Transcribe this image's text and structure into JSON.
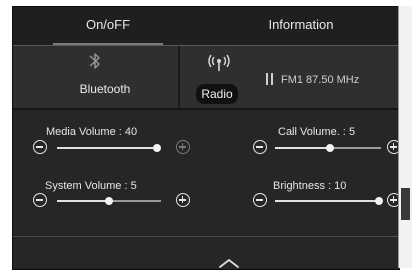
{
  "tabs": [
    {
      "label": "On/oFF",
      "active": true
    },
    {
      "label": "Information",
      "active": false
    }
  ],
  "bluetooth": {
    "label": "Bluetooth",
    "icon": "bluetooth-icon"
  },
  "radio": {
    "label": "Radio",
    "icon": "radio-antenna-icon",
    "status_icon": "pause-icon",
    "station": "FM1 87.50 MHz"
  },
  "sliders": {
    "media_volume": {
      "label": "Media Volume :",
      "value": "40",
      "level": 1.0
    },
    "call_volume": {
      "label": "Call Volume. :",
      "value": "5",
      "level": 0.52
    },
    "system_volume": {
      "label": "System Volume :",
      "value": "5",
      "level": 0.5
    },
    "brightness": {
      "label": "Brightness :",
      "value": "10",
      "level": 1.0
    }
  },
  "collapse": {
    "icon": "chevron-up-icon"
  },
  "colors": {
    "panel": "#262626",
    "tab_bar": "#1f1f1f",
    "text": "#e6e6e6"
  }
}
